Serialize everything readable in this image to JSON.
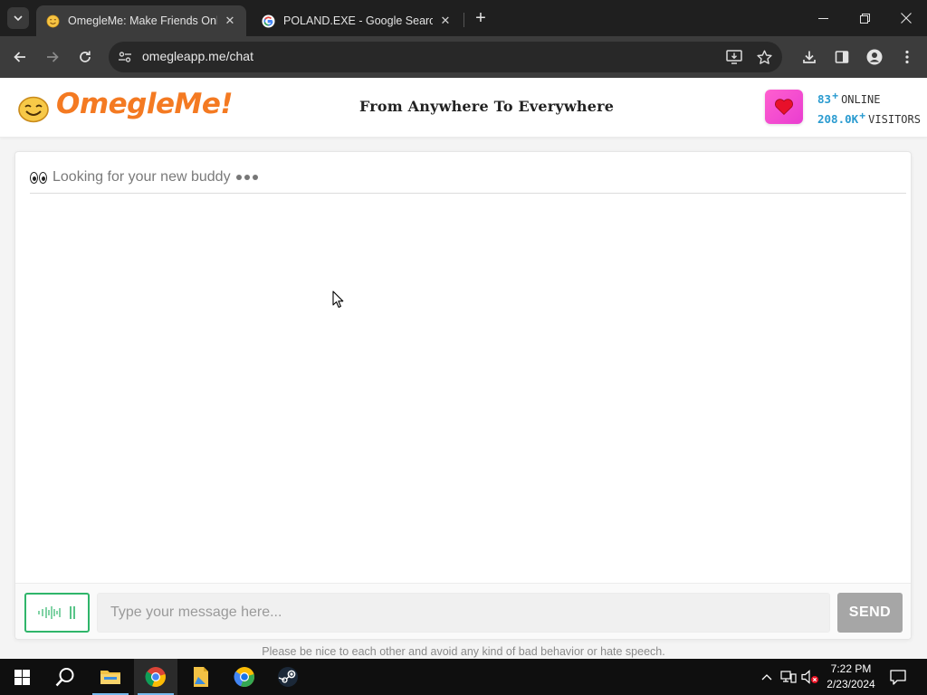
{
  "browser": {
    "tabs": [
      {
        "title": "OmegleMe: Make Friends Online",
        "favicon": "smiley-favicon",
        "active": true
      },
      {
        "title": "POLAND.EXE - Google Search",
        "favicon": "google-favicon",
        "active": false
      }
    ],
    "url": "omegleapp.me/chat"
  },
  "header": {
    "logo_text": "OmegleMe!",
    "tagline": "From Anywhere To Everywhere",
    "online_count": "83",
    "online_label": "ONLINE",
    "visitors_count": "208.0K",
    "visitors_label": "VISITORS",
    "plus": "+"
  },
  "chat": {
    "status_text": "Looking for your new buddy",
    "input_placeholder": "Type your message here...",
    "send_label": "SEND"
  },
  "footer": {
    "note": "Please be nice to each other and avoid any kind of bad behavior or hate speech."
  },
  "taskbar": {
    "time": "7:22 PM",
    "date": "2/23/2024"
  },
  "colors": {
    "brand": "#f47a22",
    "accent_blue": "#2a9bd0",
    "voice_green": "#2fb56a",
    "send_disabled": "#a6a6a6",
    "heart_pink": "#ff5fcf"
  }
}
